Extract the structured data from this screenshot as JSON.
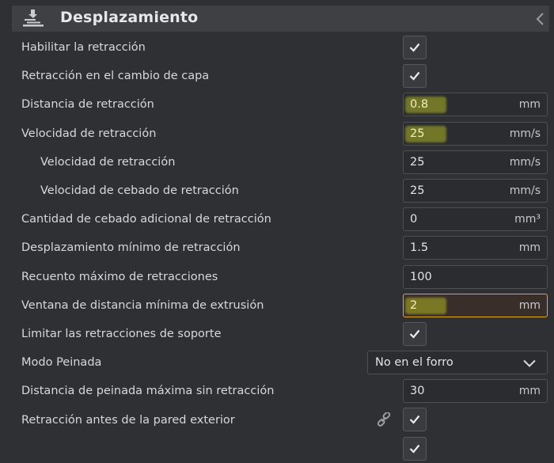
{
  "header": {
    "title": "Desplazamiento",
    "icon": "travel-icon",
    "collapse_icon": "chevron-left-icon"
  },
  "rows": [
    {
      "label": "Habilitar la retracción",
      "type": "checkbox",
      "checked": true,
      "indent": 0
    },
    {
      "label": "Retracción en el cambio de capa",
      "type": "checkbox",
      "checked": true,
      "indent": 0
    },
    {
      "label": "Distancia de retracción",
      "type": "number",
      "value": "0.8",
      "unit": "mm",
      "indent": 0,
      "highlight": true
    },
    {
      "label": "Velocidad de retracción",
      "type": "number",
      "value": "25",
      "unit": "mm/s",
      "indent": 0,
      "highlight": true
    },
    {
      "label": "Velocidad de retracción",
      "type": "number",
      "value": "25",
      "unit": "mm/s",
      "indent": 1
    },
    {
      "label": "Velocidad de cebado de retracción",
      "type": "number",
      "value": "25",
      "unit": "mm/s",
      "indent": 1
    },
    {
      "label": "Cantidad de cebado adicional de retracción",
      "type": "number",
      "value": "0",
      "unit": "mm³",
      "indent": 0
    },
    {
      "label": "Desplazamiento mínimo de retracción",
      "type": "number",
      "value": "1.5",
      "unit": "mm",
      "indent": 0
    },
    {
      "label": "Recuento máximo de retracciones",
      "type": "number",
      "value": "100",
      "unit": "",
      "indent": 0
    },
    {
      "label": "Ventana de distancia mínima de extrusión",
      "type": "number",
      "value": "2",
      "unit": "mm",
      "indent": 0,
      "highlight": true,
      "warning": true
    },
    {
      "label": "Limitar las retracciones de soporte",
      "type": "checkbox",
      "checked": true,
      "indent": 0
    },
    {
      "label": "Modo Peinada",
      "type": "select",
      "value": "No en el forro",
      "indent": 0
    },
    {
      "label": "Distancia de peinada máxima sin retracción",
      "type": "number",
      "value": "30",
      "unit": "mm",
      "indent": 0
    },
    {
      "label": "Retracción antes de la pared exterior",
      "type": "checkbox",
      "checked": true,
      "indent": 0,
      "linked": true
    },
    {
      "label": "",
      "type": "checkbox",
      "checked": true,
      "indent": 0
    }
  ],
  "colors": {
    "accent_warning": "#e0a91e",
    "highlight": "#d4de1e",
    "background": "#2f3033"
  }
}
